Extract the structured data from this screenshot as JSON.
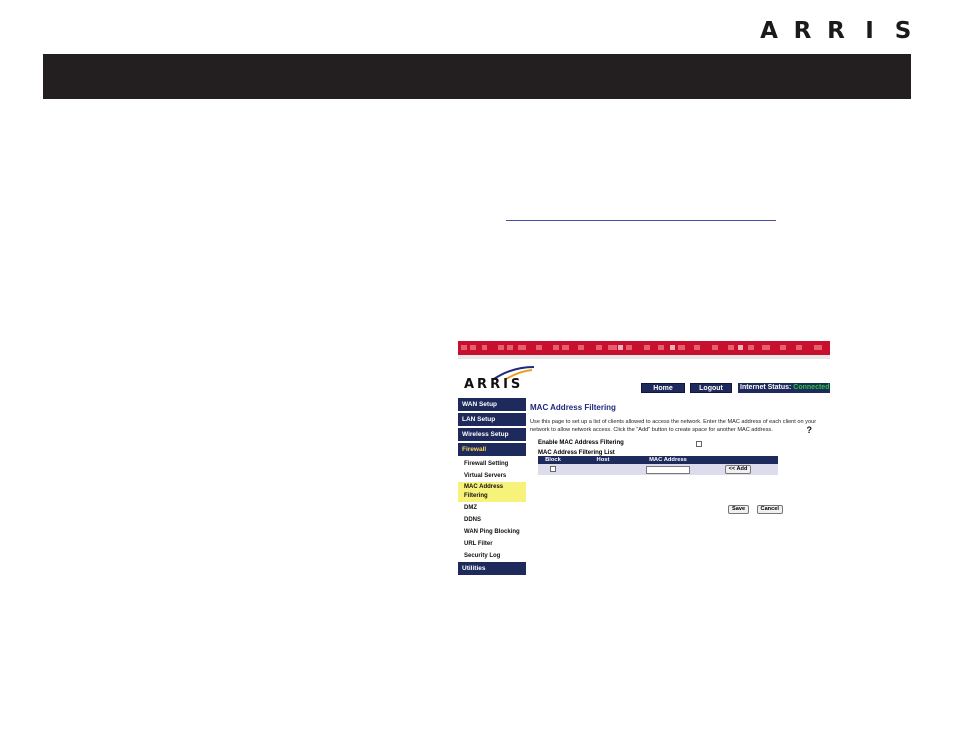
{
  "brand": {
    "logo_letters": [
      "A",
      "R",
      "R",
      "I",
      "S"
    ]
  },
  "screenshot": {
    "logo_text": "ARRIS",
    "top_buttons": [
      "Home",
      "Logout"
    ],
    "status_label": "Internet Status:",
    "status_value": "Connected",
    "status_color": "#22cc33",
    "sidebar": {
      "main_items": [
        "WAN Setup",
        "LAN Setup",
        "Wireless Setup",
        "Firewall"
      ],
      "active_item": "Firewall",
      "sub_items": [
        "Firewall Setting",
        "Virtual Servers",
        "MAC Address Filtering",
        "DMZ",
        "DDNS",
        "WAN Ping Blocking",
        "URL Filter",
        "Security Log"
      ],
      "highlighted_sub_item": "MAC Address Filtering",
      "bottom_item": "Utilities"
    },
    "page_title": "MAC Address Filtering",
    "description": "Use this page to set up a list of clients allowed to access the network. Enter the MAC address of each client on your network to allow network access. Click the \"Add\" button to create space for another MAC address.",
    "help_icon": "?",
    "enable_label": "Enable MAC Address Filtering",
    "list_title": "MAC Address Filtering List",
    "table": {
      "headers": [
        "Block",
        "Host",
        "MAC Address",
        ""
      ],
      "add_button": "<< Add"
    },
    "save_button": "Save",
    "cancel_button": "Cancel"
  },
  "colors": {
    "title_bar": "#231f20",
    "banner_red": "#c8102e",
    "nav_blue": "#1f2a5c",
    "highlight": "#f7f27a"
  }
}
